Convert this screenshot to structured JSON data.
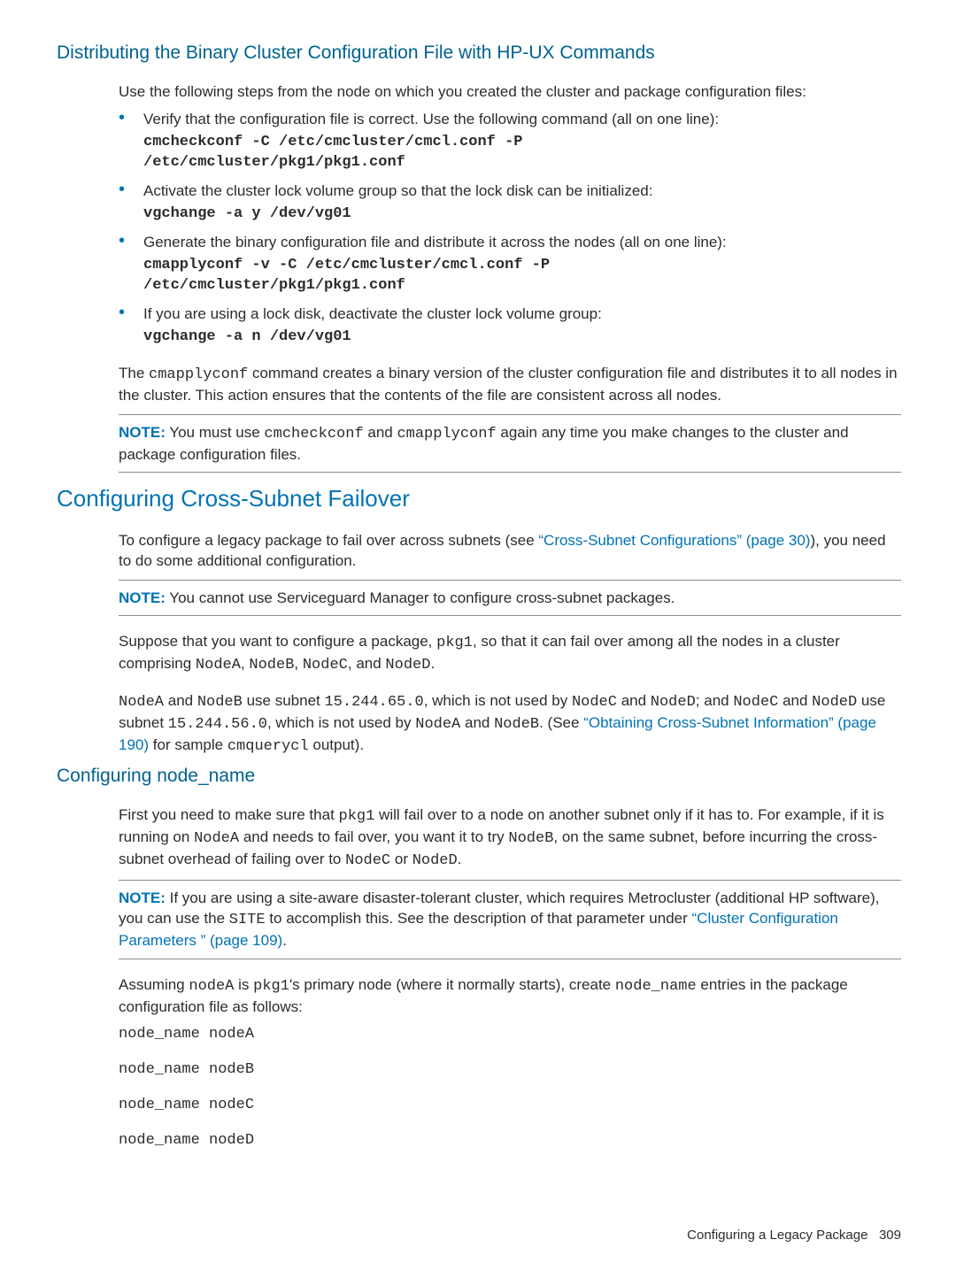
{
  "headings": {
    "dist": "Distributing the Binary Cluster Configuration File with HP-UX Commands",
    "cross": "Configuring Cross-Subnet Failover",
    "nodename": "Configuring node_name"
  },
  "dist": {
    "intro": "Use the following steps from the node on which you created the cluster and package configuration files:",
    "b1": "Verify that the configuration file is correct. Use the following command (all on one line):",
    "b1cmd": "cmcheckconf -C /etc/cmcluster/cmcl.conf -P\n/etc/cmcluster/pkg1/pkg1.conf",
    "b2": "Activate the cluster lock volume group so that the lock disk can be initialized:",
    "b2cmd": "vgchange -a y /dev/vg01",
    "b3": "Generate the binary configuration file and distribute it across the nodes (all on one line):",
    "b3cmd": "cmapplyconf -v -C /etc/cmcluster/cmcl.conf -P\n/etc/cmcluster/pkg1/pkg1.conf",
    "b4": "If you are using a lock disk, deactivate the cluster lock volume group:",
    "b4cmd": "vgchange -a n /dev/vg01",
    "after_pre": "The ",
    "after_cmd": "cmapplyconf",
    "after_post": " command creates a binary version of the cluster configuration file and distributes it to all nodes in the cluster. This action ensures that the contents of the file are consistent across all nodes."
  },
  "note1": {
    "label": "NOTE:",
    "t1": "   You must use ",
    "m1": "cmcheckconf",
    "t2": " and ",
    "m2": "cmapplyconf",
    "t3": " again any time you make changes to the cluster and package configuration files."
  },
  "cross": {
    "p1a": "To configure a legacy package to fail over across subnets (see ",
    "link1": "“Cross-Subnet Configurations” (page 30)",
    "p1b": "), you need to do some additional configuration."
  },
  "note2": {
    "label": "NOTE:",
    "text": "   You cannot use Serviceguard Manager to configure cross-subnet packages."
  },
  "sup": {
    "p1a": "Suppose that you want to configure a package, ",
    "m1": "pkg1",
    "p1b": ", so that it can fail over among all the nodes in a cluster comprising ",
    "mA": "NodeA",
    "mB": "NodeB",
    "mC": "NodeC",
    "mD": "NodeD",
    "comma": ", ",
    "and": ", and ",
    "dot": "."
  },
  "sub": {
    "t1": " and ",
    "t2": " use subnet ",
    "ip1": "15.244.65.0",
    "t3": ", which is not used by ",
    "t4": "; and ",
    "ip2": "15.244.56.0",
    "t5": ". (See ",
    "link": "“Obtaining Cross-Subnet Information” (page 190)",
    "t6": " for sample ",
    "cmd": "cmquerycl",
    "t7": " output)."
  },
  "nname": {
    "p1a": "First you need to make sure that ",
    "m1": "pkg1",
    "p1b": " will fail over to a node on another subnet only if it has to. For example, if it is running on ",
    "mA": "NodeA",
    "p1c": " and needs to fail over, you want it to try ",
    "mB": "NodeB",
    "p1d": ", on the same subnet, before incurring the cross-subnet overhead of failing over to ",
    "mC": "NodeC",
    "p1e": " or ",
    "mD": "NodeD",
    "p1f": "."
  },
  "note3": {
    "label": "NOTE:",
    "t1": "   If you are using a site-aware disaster-tolerant cluster, which requires Metrocluster (additional HP software), you can use the ",
    "m1": "SITE",
    "t2": " to accomplish this. See the description of that parameter under ",
    "link": "“Cluster Configuration Parameters ” (page 109)",
    "t3": "."
  },
  "assume": {
    "t1": "Assuming ",
    "m1": "nodeA",
    "t2": " is ",
    "m2": "pkg1",
    "t3": "'s primary node (where it normally starts), create ",
    "m3": "node_name",
    "t4": " entries in the package configuration file as follows:"
  },
  "entries": [
    "node_name nodeA",
    "node_name nodeB",
    "node_name nodeC",
    "node_name nodeD"
  ],
  "footer": {
    "text": "Configuring a Legacy Package",
    "page": "309"
  }
}
